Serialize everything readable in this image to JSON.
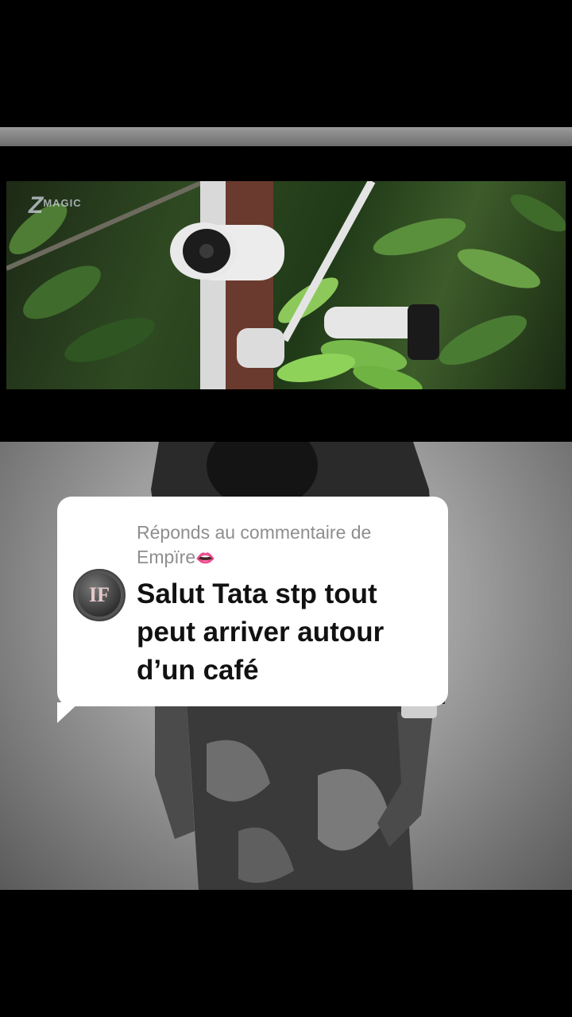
{
  "video": {
    "watermark_z": "Z",
    "watermark_text": "MAGIC"
  },
  "reply": {
    "header_line1": "Réponds au commentaire de",
    "header_line2": "Empïre",
    "header_emoji": "👄",
    "avatar_initials": "IF",
    "comment_text": "Salut Tata stp tout peut arriver autour d’un café"
  },
  "colors": {
    "bubble_bg": "#ffffff",
    "reply_header": "#8e8e8e",
    "comment_text": "#111111",
    "page_bg": "#000000"
  }
}
